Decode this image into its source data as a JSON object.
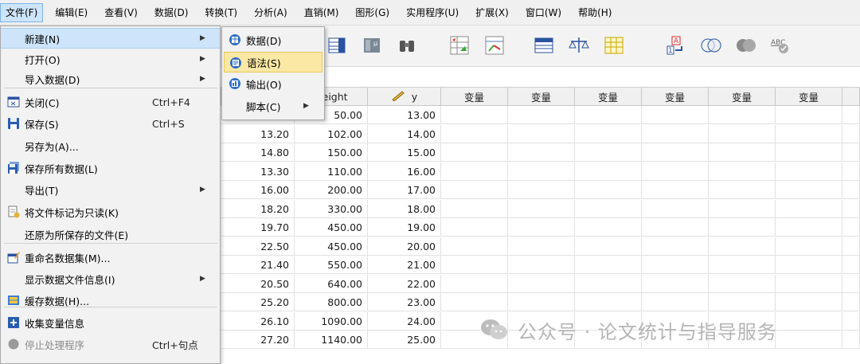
{
  "menubar": [
    {
      "label": "文件(F)",
      "active": true
    },
    {
      "label": "编辑(E)"
    },
    {
      "label": "查看(V)"
    },
    {
      "label": "数据(D)"
    },
    {
      "label": "转换(T)"
    },
    {
      "label": "分析(A)"
    },
    {
      "label": "直销(M)"
    },
    {
      "label": "图形(G)"
    },
    {
      "label": "实用程序(U)"
    },
    {
      "label": "扩展(X)"
    },
    {
      "label": "窗口(W)"
    },
    {
      "label": "帮助(H)"
    }
  ],
  "file_menu": [
    {
      "label": "新建(N)",
      "shortcut": "",
      "submenu": true,
      "highlighted": true,
      "icon": ""
    },
    {
      "label": "打开(O)",
      "shortcut": "",
      "submenu": true,
      "icon": ""
    },
    {
      "label": "导入数据(D)",
      "shortcut": "",
      "submenu": true,
      "icon": ""
    },
    {
      "label": "关闭(C)",
      "shortcut": "Ctrl+F4",
      "icon": "close-window-icon"
    },
    {
      "label": "保存(S)",
      "shortcut": "Ctrl+S",
      "icon": "save-icon"
    },
    {
      "label": "另存为(A)...",
      "shortcut": "",
      "icon": ""
    },
    {
      "label": "保存所有数据(L)",
      "shortcut": "",
      "icon": "save-all-icon"
    },
    {
      "label": "导出(T)",
      "shortcut": "",
      "submenu": true,
      "icon": ""
    },
    {
      "label": "将文件标记为只读(K)",
      "shortcut": "",
      "icon": "readonly-icon"
    },
    {
      "label": "还原为所保存的文件(E)",
      "shortcut": "",
      "icon": ""
    },
    {
      "label": "重命名数据集(M)...",
      "shortcut": "",
      "icon": "rename-dataset-icon"
    },
    {
      "label": "显示数据文件信息(I)",
      "shortcut": "",
      "submenu": true,
      "icon": ""
    },
    {
      "label": "缓存数据(H)...",
      "shortcut": "",
      "icon": "cache-data-icon"
    },
    {
      "label": "收集变量信息",
      "shortcut": "",
      "icon": "plus-icon"
    },
    {
      "label": "停止处理程序",
      "shortcut": "Ctrl+句点",
      "disabled": true,
      "icon": "stop-icon"
    }
  ],
  "new_submenu": [
    {
      "label": "数据(D)",
      "icon": "data-icon"
    },
    {
      "label": "语法(S)",
      "icon": "syntax-icon",
      "highlighted": true
    },
    {
      "label": "输出(O)",
      "icon": "output-icon"
    },
    {
      "label": "脚本(C)",
      "icon": "",
      "submenu": true
    }
  ],
  "grid": {
    "columns": [
      "weight",
      "y",
      "变量",
      "变量",
      "变量",
      "变量",
      "变量",
      "变量"
    ],
    "rows": [
      {
        "x": "",
        "weight": "50.00",
        "y": "13.00"
      },
      {
        "x": "13.20",
        "weight": "102.00",
        "y": "14.00"
      },
      {
        "x": "14.80",
        "weight": "150.00",
        "y": "15.00"
      },
      {
        "x": "13.30",
        "weight": "110.00",
        "y": "16.00"
      },
      {
        "x": "16.00",
        "weight": "200.00",
        "y": "17.00"
      },
      {
        "x": "18.20",
        "weight": "330.00",
        "y": "18.00"
      },
      {
        "x": "19.70",
        "weight": "450.00",
        "y": "19.00"
      },
      {
        "x": "22.50",
        "weight": "450.00",
        "y": "20.00"
      },
      {
        "x": "21.40",
        "weight": "550.00",
        "y": "21.00"
      },
      {
        "x": "20.50",
        "weight": "640.00",
        "y": "22.00"
      },
      {
        "x": "25.20",
        "weight": "800.00",
        "y": "23.00"
      },
      {
        "x": "26.10",
        "weight": "1090.00",
        "y": "24.00"
      },
      {
        "x": "27.20",
        "weight": "1140.00",
        "y": "25.00"
      }
    ]
  },
  "watermark": "公众号 · 论文统计与指导服务",
  "colors": {
    "menu_highlight": "#cde4fa",
    "submenu_highlight": "#fbe8a5",
    "icon_blue": "#2f6fc4"
  }
}
